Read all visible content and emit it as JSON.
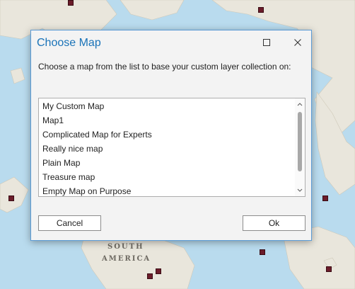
{
  "map": {
    "label_south": "SOUTH",
    "label_america": "AMERICA"
  },
  "dialog": {
    "title": "Choose Map",
    "prompt": "Choose a map from the list to base your custom layer collection on:",
    "maximize_icon": "maximize-icon",
    "close_icon": "close-icon",
    "items": [
      "My Custom Map",
      "Map1",
      "Complicated Map for Experts",
      "Really nice map",
      "Plain Map",
      "Treasure map",
      "Empty Map on Purpose"
    ],
    "cancel_label": "Cancel",
    "ok_label": "Ok"
  },
  "colors": {
    "title": "#1a73b8",
    "dialog_border": "#5b9bd5",
    "ocean": "#b9dbee",
    "land": "#e9e6dc",
    "marker": "#6b1c2a"
  }
}
